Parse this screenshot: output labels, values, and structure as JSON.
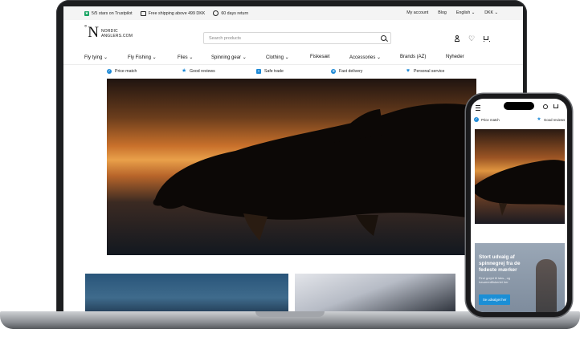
{
  "topbar": {
    "trustpilot": "5/5 stars on Trustpilot",
    "shipping": "Free shipping above 499 DKK",
    "returns": "60 days return",
    "my_account": "My account",
    "blog": "Blog",
    "language": "English ⌄",
    "currency": "DKK ⌄"
  },
  "header": {
    "logo_line1": "NORDIC",
    "logo_line2": "ANGLERS.COM",
    "search_placeholder": "Search products"
  },
  "nav": [
    "Fly tying ⌄",
    "Fly Fishing ⌄",
    "Flies ⌄",
    "Spinning gear ⌄",
    "Clothing ⌄",
    "Fiskesæt",
    "Accessories ⌄",
    "Brands (AZ)",
    "Nyheder"
  ],
  "usp": [
    "Price match",
    "Good reviews",
    "Safe trade",
    "Fast delivery",
    "Personal service"
  ],
  "phone": {
    "usp": [
      "Price match",
      "Good reviews"
    ],
    "banner_title": "Stort udvalg af spinnegrej fra de fedeste mærker",
    "banner_sub": "Find grejet til laks-, og havørredfiskeriet her",
    "cta": "Se udvalget her"
  },
  "colors": {
    "accent": "#1d89d6",
    "trustpilot": "#19a463"
  }
}
